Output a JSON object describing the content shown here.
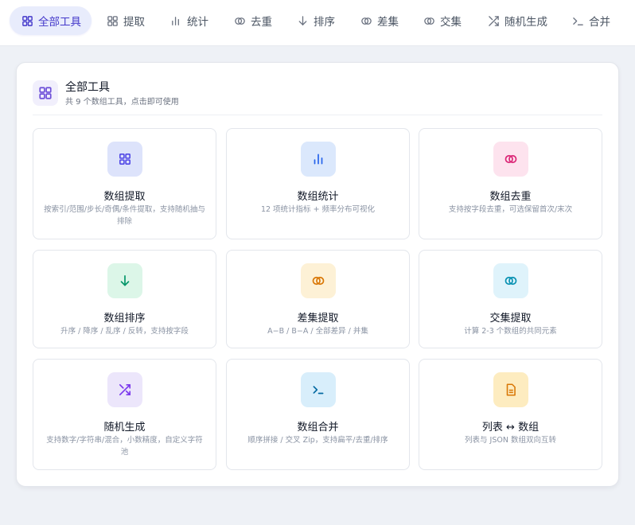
{
  "tabs": [
    {
      "label": "全部工具",
      "icon": "grid-icon"
    },
    {
      "label": "提取",
      "icon": "grid-icon"
    },
    {
      "label": "统计",
      "icon": "bar-chart-icon"
    },
    {
      "label": "去重",
      "icon": "overlap-circles-icon"
    },
    {
      "label": "排序",
      "icon": "arrow-down-icon"
    },
    {
      "label": "差集",
      "icon": "overlap-circles-icon"
    },
    {
      "label": "交集",
      "icon": "overlap-circles-icon"
    },
    {
      "label": "随机生成",
      "icon": "shuffle-icon"
    },
    {
      "label": "合并",
      "icon": "terminal-icon"
    }
  ],
  "panel": {
    "title": "全部工具",
    "subtitle": "共 9 个数组工具，点击即可使用",
    "icon": "grid-icon"
  },
  "cards": [
    {
      "title": "数组提取",
      "desc": "按索引/范围/步长/奇偶/条件提取，支持随机抽与排除",
      "icon": "grid-icon",
      "bg": "#dde3fb",
      "fg": "#4f46e5"
    },
    {
      "title": "数组统计",
      "desc": "12 项统计指标 + 频率分布可视化",
      "icon": "bar-chart-icon",
      "bg": "#dbe8fc",
      "fg": "#2563eb"
    },
    {
      "title": "数组去重",
      "desc": "支持按字段去重，可选保留首次/末次",
      "icon": "overlap-circles-icon",
      "bg": "#fde3ee",
      "fg": "#db2777"
    },
    {
      "title": "数组排序",
      "desc": "升序 / 降序 / 乱序 / 反转，支持按字段",
      "icon": "arrow-down-icon",
      "bg": "#dcf6e8",
      "fg": "#059669"
    },
    {
      "title": "差集提取",
      "desc": "A−B / B−A / 全部差异 / 并集",
      "icon": "overlap-circles-icon",
      "bg": "#fdf1d6",
      "fg": "#d97706"
    },
    {
      "title": "交集提取",
      "desc": "计算 2-3 个数组的共同元素",
      "icon": "overlap-circles-icon",
      "bg": "#dff3fb",
      "fg": "#0891b2"
    },
    {
      "title": "随机生成",
      "desc": "支持数字/字符串/混合，小数精度，自定义字符池",
      "icon": "shuffle-icon",
      "bg": "#ece6fb",
      "fg": "#7c3aed"
    },
    {
      "title": "数组合并",
      "desc": "顺序拼接 / 交叉 Zip，支持扁平/去重/排序",
      "icon": "terminal-icon",
      "bg": "#d8eefb",
      "fg": "#0369a1"
    },
    {
      "title": "列表 ↔ 数组",
      "desc": "列表与 JSON 数组双向互转",
      "icon": "document-icon",
      "bg": "#fdecc0",
      "fg": "#d97706"
    }
  ],
  "colors": {
    "accent": "#4338ca",
    "active_tab_bg": "#e8ecfc",
    "page_bg": "#eef1f6"
  }
}
